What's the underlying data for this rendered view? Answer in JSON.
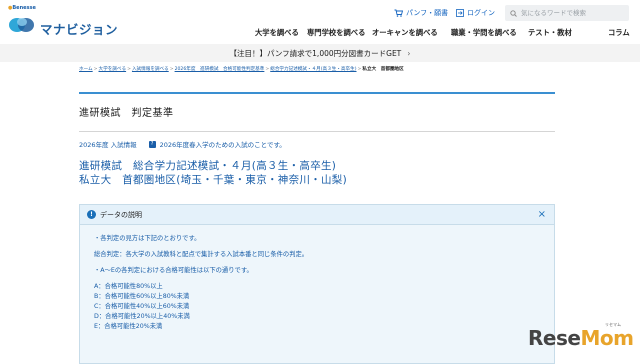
{
  "brand": {
    "company": "Benesse",
    "logo_text": "マナビジョン"
  },
  "utility": {
    "pamphlet": "パンフ・願書",
    "login": "ログイン",
    "search_placeholder": "気になるワードで検索"
  },
  "nav": {
    "items": [
      {
        "label": "大学を調べる",
        "dropdown": false
      },
      {
        "label": "専門学校を調べる",
        "dropdown": false
      },
      {
        "label": "オーキャンを調べる",
        "dropdown": true
      },
      {
        "label": "職業・学問を調べる",
        "dropdown": true
      },
      {
        "label": "テスト・教材",
        "dropdown": false
      },
      {
        "label": "コラム",
        "dropdown": false
      }
    ]
  },
  "banner": {
    "text": "【注目！】パンフ請求で1,000円分図書カードGET",
    "arrow": "›"
  },
  "breadcrumb": {
    "items": [
      "ホーム",
      "大学を調べる",
      "入試情報を調べる",
      "2026年度　進研模試　合格可能性判定基準",
      "総合学力記述模試・４月(高３生・高卒生)",
      "私立大　首都圏地区"
    ],
    "separator": ">"
  },
  "page": {
    "title": "進研模試　判定基準"
  },
  "meta": {
    "year_label": "2026年度 入試情報",
    "badge": "?",
    "note": "2026年度春入学のための入試のことです。"
  },
  "exam": {
    "line1": "進研模試　総合学力記述模試・４月(高３生・高卒生)",
    "line2": "私立大　首都圏地区(埼玉・千葉・東京・神奈川・山梨)"
  },
  "info": {
    "heading": "データの説明",
    "close": "×",
    "para1": "・各判定の見方は下記のとおりです。",
    "para2": "総合判定：各大学の入試教科と配点で集計する入試本番と同じ条件の判定。",
    "para3": "・A～Eの各判定における合格可能性は以下の通りです。",
    "grades": [
      "A：合格可能性80%以上",
      "B：合格可能性60%以上80%未満",
      "C：合格可能性40%以上60%未満",
      "D：合格可能性20%以上40%未満",
      "E：合格可能性20%未満"
    ]
  },
  "watermark": {
    "text_a": "Rese",
    "text_b": "Mom",
    "ruby": "リセマム"
  },
  "colors": {
    "accent": "#1a5ea8",
    "rule": "#3a8fd1",
    "infobox_bg": "#eef6fb",
    "banner_bg": "#f3f3f3"
  }
}
